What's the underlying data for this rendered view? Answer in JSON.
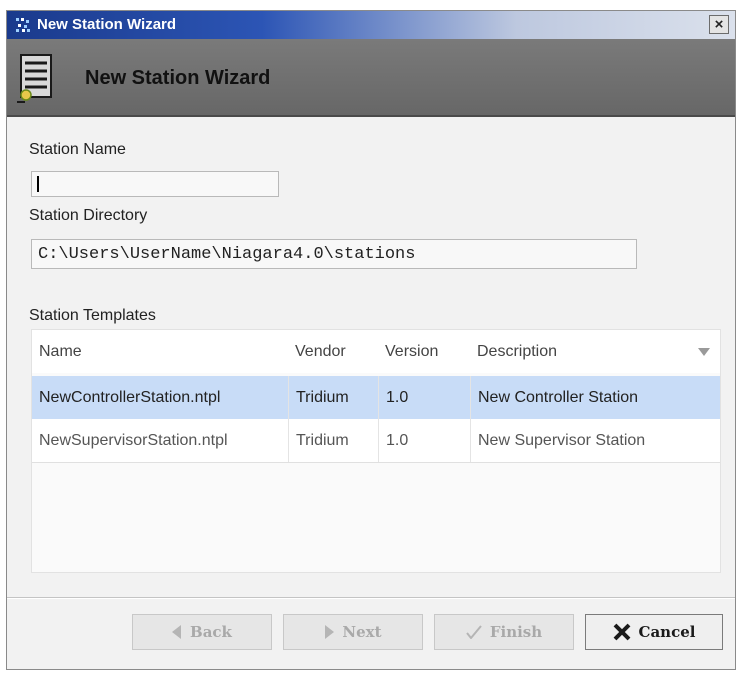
{
  "window": {
    "title": "New Station Wizard",
    "close_label": "×"
  },
  "banner": {
    "title": "New Station Wizard",
    "icon": "station-wizard-icon"
  },
  "form": {
    "station_name_label": "Station Name",
    "station_name_value": "",
    "station_directory_label": "Station Directory",
    "station_directory_value": "C:\\Users\\UserName\\Niagara4.0\\stations"
  },
  "templates": {
    "label": "Station Templates",
    "columns": [
      "Name",
      "Vendor",
      "Version",
      "Description"
    ],
    "rows": [
      {
        "name": "NewControllerStation.ntpl",
        "vendor": "Tridium",
        "version": "1.0",
        "description": "New Controller Station",
        "selected": true
      },
      {
        "name": "NewSupervisorStation.ntpl",
        "vendor": "Tridium",
        "version": "1.0",
        "description": "New Supervisor Station",
        "selected": false
      }
    ]
  },
  "buttons": {
    "back": "Back",
    "next": "Next",
    "finish": "Finish",
    "cancel": "Cancel"
  },
  "colors": {
    "selection": "#c8dcf7",
    "titlebar": "#1a3a8c",
    "banner": "#6e6e6e"
  }
}
